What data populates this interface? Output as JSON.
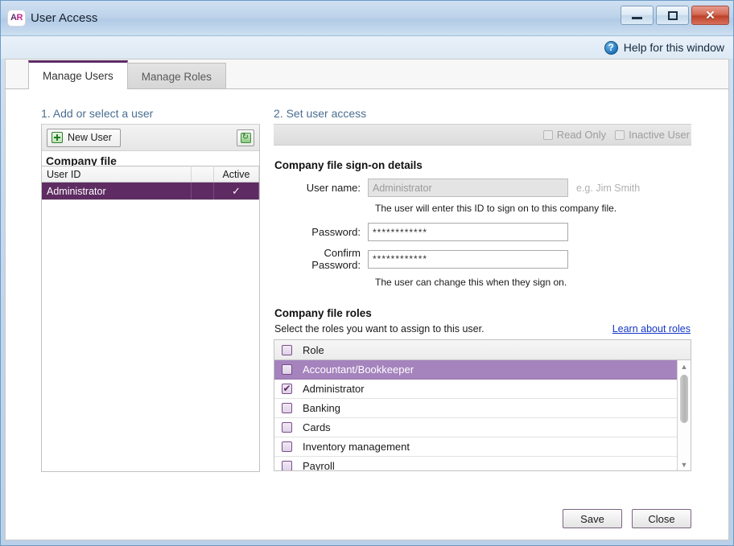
{
  "window": {
    "title": "User Access",
    "icon_text_a": "A",
    "icon_text_r": "R",
    "minimize_label": "",
    "maximize_label": "",
    "close_label": "✕"
  },
  "help": {
    "label": "Help for this window",
    "icon": "question-mark-icon",
    "icon_glyph": "?"
  },
  "tabs": [
    {
      "label": "Manage Users",
      "active": true
    },
    {
      "label": "Manage Roles",
      "active": false
    }
  ],
  "left_panel": {
    "step_title": "1. Add or select a user",
    "new_user_button": "New User",
    "recycle_button_icon": "recycle-icon",
    "company_label": "Company file",
    "table": {
      "columns": [
        "User ID",
        "",
        "Active"
      ],
      "rows": [
        {
          "user_id": "Administrator",
          "spacer": "",
          "active": "✓",
          "selected": true
        }
      ]
    }
  },
  "right_panel": {
    "step_title": "2. Set user access",
    "access_bar": {
      "read_only_label": "Read Only",
      "inactive_user_label": "Inactive User"
    },
    "signon": {
      "heading": "Company file sign-on details",
      "username_label": "User name:",
      "username_value": "Administrator",
      "username_example": "e.g. Jim Smith",
      "username_help": "The user will enter this ID to sign on to this company file.",
      "password_label": "Password:",
      "password_value": "************",
      "confirm_label": "Confirm Password:",
      "confirm_value": "************",
      "password_help": "The user can change this when they sign on."
    },
    "roles": {
      "heading": "Company file roles",
      "subtitle": "Select the roles you want to assign to this user.",
      "learn_link": "Learn about roles",
      "header_label": "Role",
      "items": [
        {
          "label": "Accountant/Bookkeeper",
          "checked": false,
          "highlighted": true
        },
        {
          "label": "Administrator",
          "checked": true,
          "highlighted": false
        },
        {
          "label": "Banking",
          "checked": false,
          "highlighted": false
        },
        {
          "label": "Cards",
          "checked": false,
          "highlighted": false
        },
        {
          "label": "Inventory management",
          "checked": false,
          "highlighted": false
        },
        {
          "label": "Payroll",
          "checked": false,
          "highlighted": false
        }
      ]
    }
  },
  "footer": {
    "save_label": "Save",
    "close_label": "Close"
  },
  "colors": {
    "accent_purple": "#5e2b62",
    "highlight_purple": "#a583bd",
    "link_blue": "#1436c8",
    "step_title_blue": "#4a6e91"
  }
}
